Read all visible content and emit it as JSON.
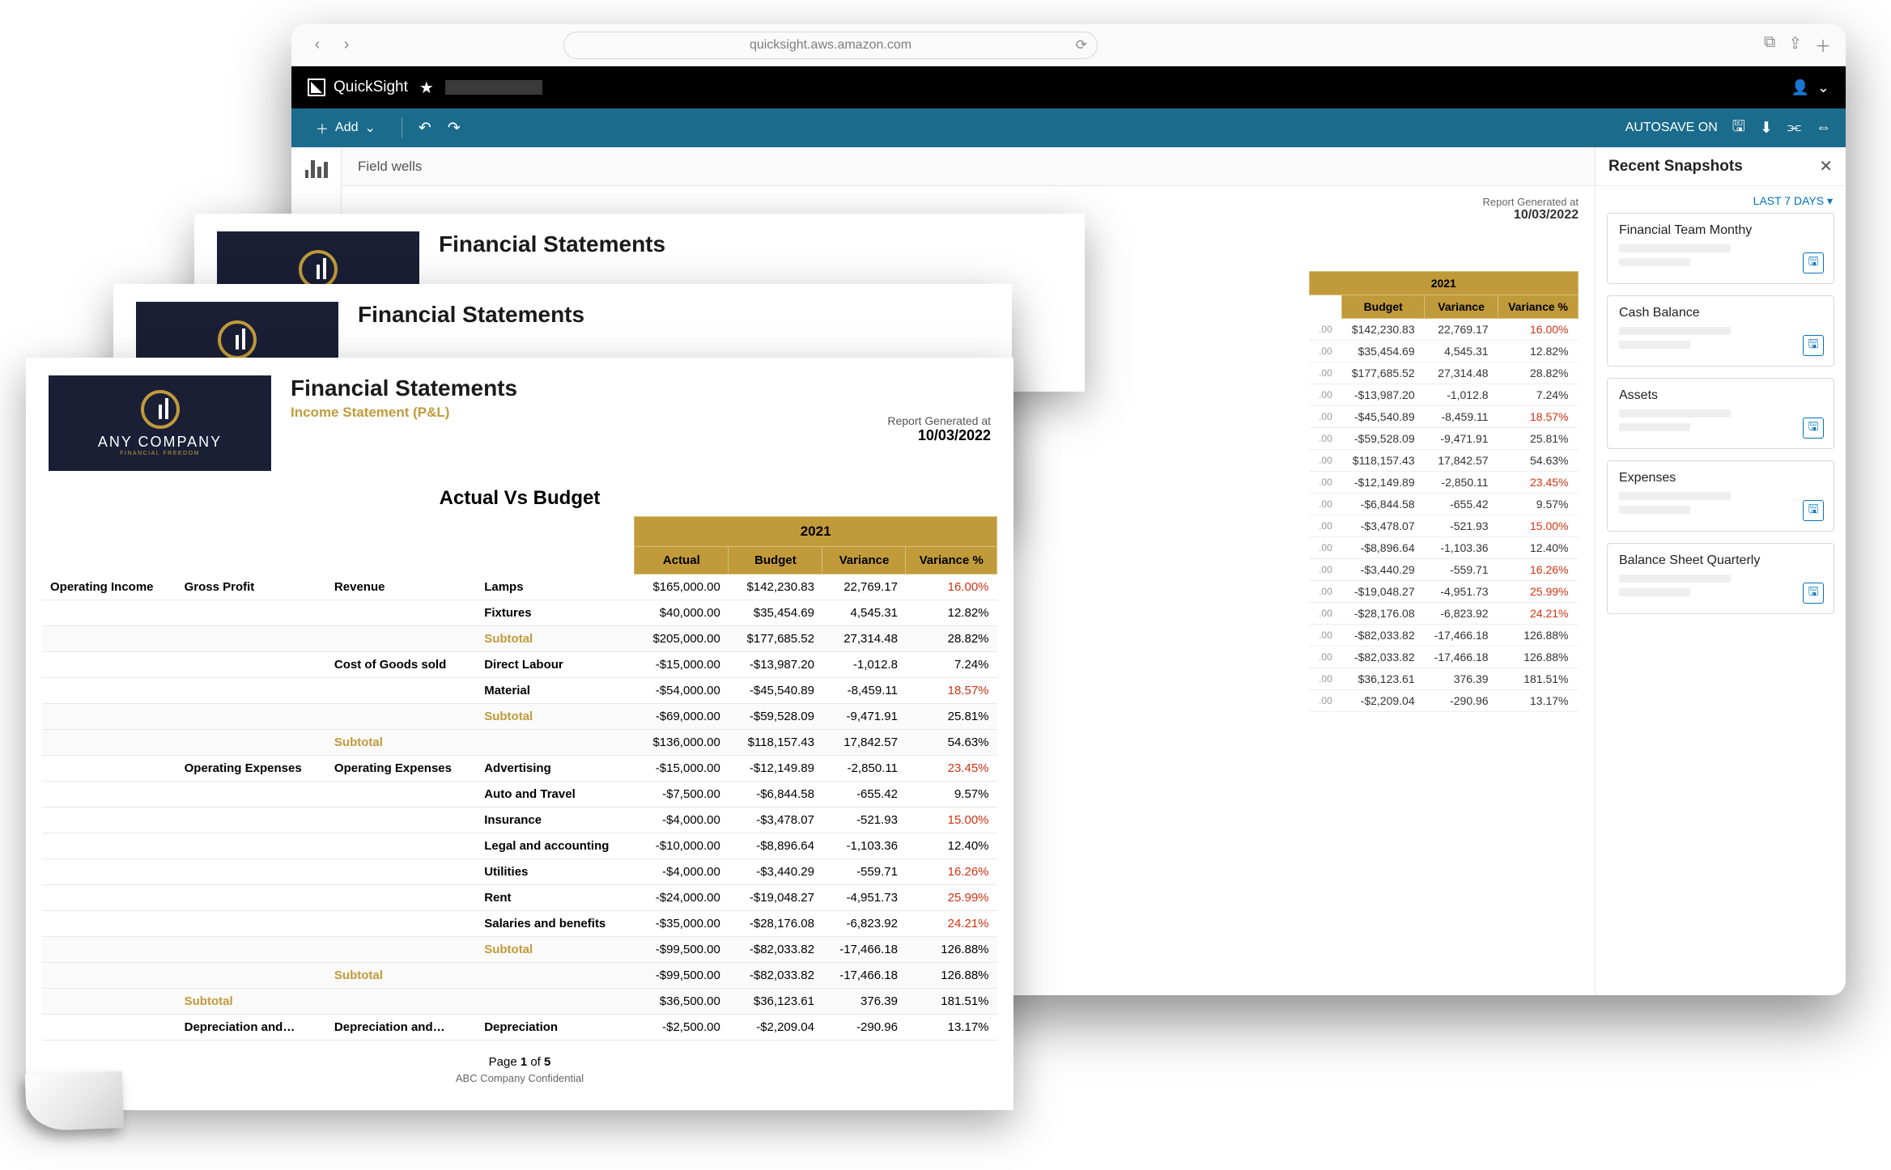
{
  "browser": {
    "url": "quicksight.aws.amazon.com"
  },
  "app": {
    "name": "QuickSight"
  },
  "toolbar": {
    "add": "Add",
    "autosave": "AUTOSAVE ON"
  },
  "fieldwells": "Field wells",
  "panel": {
    "title": "Recent Snapshots",
    "filter": "LAST 7 DAYS",
    "items": [
      "Financial Team Monthy",
      "Cash Balance",
      "Assets",
      "Expenses",
      "Balance Sheet Quarterly"
    ]
  },
  "report": {
    "company": "ANY COMPANY",
    "tag": "FINANCIAL FREEDOM",
    "title": "Financial Statements",
    "subtitle": "Income Statement  (P&L)",
    "generated_label": "Report Generated at",
    "generated_date": "10/03/2022",
    "section": "Actual Vs Budget",
    "year": "2021",
    "cols": [
      "Actual",
      "Budget",
      "Variance",
      "Variance %"
    ],
    "pager": "Page 1 of 5",
    "pager_b1": "1",
    "pager_b2": "5",
    "conf": "ABC Company Confidential"
  },
  "rows": [
    {
      "l1": "Operating Income",
      "l2": "Gross Profit",
      "l3": "Revenue",
      "l4": "Lamps",
      "a": "$165,000.00",
      "b": "$142,230.83",
      "v": "22,769.17",
      "p": "16.00%",
      "neg": true
    },
    {
      "l4": "Fixtures",
      "a": "$40,000.00",
      "b": "$35,454.69",
      "v": "4,545.31",
      "p": "12.82%"
    },
    {
      "sub": true,
      "l4": "Subtotal",
      "a": "$205,000.00",
      "b": "$177,685.52",
      "v": "27,314.48",
      "p": "28.82%"
    },
    {
      "l3": "Cost of Goods sold",
      "l4": "Direct Labour",
      "a": "-$15,000.00",
      "b": "-$13,987.20",
      "v": "-1,012.8",
      "p": "7.24%"
    },
    {
      "l4": "Material",
      "a": "-$54,000.00",
      "b": "-$45,540.89",
      "v": "-8,459.11",
      "p": "18.57%",
      "neg": true
    },
    {
      "sub": true,
      "l4": "Subtotal",
      "a": "-$69,000.00",
      "b": "-$59,528.09",
      "v": "-9,471.91",
      "p": "25.81%"
    },
    {
      "sub": true,
      "l3": "Subtotal",
      "a": "$136,000.00",
      "b": "$118,157.43",
      "v": "17,842.57",
      "p": "54.63%"
    },
    {
      "l2": "Operating Expenses",
      "l3": "Operating Expenses",
      "l4": "Advertising",
      "a": "-$15,000.00",
      "b": "-$12,149.89",
      "v": "-2,850.11",
      "p": "23.45%",
      "neg": true
    },
    {
      "l4": "Auto and Travel",
      "a": "-$7,500.00",
      "b": "-$6,844.58",
      "v": "-655.42",
      "p": "9.57%"
    },
    {
      "l4": "Insurance",
      "a": "-$4,000.00",
      "b": "-$3,478.07",
      "v": "-521.93",
      "p": "15.00%",
      "neg": true
    },
    {
      "l4": "Legal and accounting",
      "a": "-$10,000.00",
      "b": "-$8,896.64",
      "v": "-1,103.36",
      "p": "12.40%"
    },
    {
      "l4": "Utilities",
      "a": "-$4,000.00",
      "b": "-$3,440.29",
      "v": "-559.71",
      "p": "16.26%",
      "neg": true
    },
    {
      "l4": "Rent",
      "a": "-$24,000.00",
      "b": "-$19,048.27",
      "v": "-4,951.73",
      "p": "25.99%",
      "neg": true
    },
    {
      "l4": "Salaries and benefits",
      "a": "-$35,000.00",
      "b": "-$28,176.08",
      "v": "-6,823.92",
      "p": "24.21%",
      "neg": true
    },
    {
      "sub": true,
      "l4": "Subtotal",
      "a": "-$99,500.00",
      "b": "-$82,033.82",
      "v": "-17,466.18",
      "p": "126.88%"
    },
    {
      "sub": true,
      "l3": "Subtotal",
      "a": "-$99,500.00",
      "b": "-$82,033.82",
      "v": "-17,466.18",
      "p": "126.88%"
    },
    {
      "sub": true,
      "l2": "Subtotal",
      "a": "$36,500.00",
      "b": "$36,123.61",
      "v": "376.39",
      "p": "181.51%"
    },
    {
      "l2": "Depreciation and…",
      "l3": "Depreciation and…",
      "l4": "Depreciation",
      "a": "-$2,500.00",
      "b": "-$2,209.04",
      "v": "-290.96",
      "p": "13.17%"
    }
  ],
  "frag": {
    "generated_label": "Report Generated at",
    "date": "10/03/2022",
    "year": "2021",
    "cols": [
      "Budget",
      "Variance",
      "Variance %"
    ],
    "rows": [
      {
        "b": "$142,230.83",
        "v": "22,769.17",
        "p": "16.00%",
        "neg": true
      },
      {
        "b": "$35,454.69",
        "v": "4,545.31",
        "p": "12.82%"
      },
      {
        "b": "$177,685.52",
        "v": "27,314.48",
        "p": "28.82%"
      },
      {
        "b": "-$13,987.20",
        "v": "-1,012.8",
        "p": "7.24%"
      },
      {
        "b": "-$45,540.89",
        "v": "-8,459.11",
        "p": "18.57%",
        "neg": true
      },
      {
        "b": "-$59,528.09",
        "v": "-9,471.91",
        "p": "25.81%"
      },
      {
        "b": "$118,157.43",
        "v": "17,842.57",
        "p": "54.63%"
      },
      {
        "b": "-$12,149.89",
        "v": "-2,850.11",
        "p": "23.45%",
        "neg": true
      },
      {
        "b": "-$6,844.58",
        "v": "-655.42",
        "p": "9.57%"
      },
      {
        "b": "-$3,478.07",
        "v": "-521.93",
        "p": "15.00%",
        "neg": true
      },
      {
        "b": "-$8,896.64",
        "v": "-1,103.36",
        "p": "12.40%"
      },
      {
        "b": "-$3,440.29",
        "v": "-559.71",
        "p": "16.26%",
        "neg": true
      },
      {
        "b": "-$19,048.27",
        "v": "-4,951.73",
        "p": "25.99%",
        "neg": true
      },
      {
        "b": "-$28,176.08",
        "v": "-6,823.92",
        "p": "24.21%",
        "neg": true
      },
      {
        "b": "-$82,033.82",
        "v": "-17,466.18",
        "p": "126.88%"
      },
      {
        "b": "-$82,033.82",
        "v": "-17,466.18",
        "p": "126.88%"
      },
      {
        "b": "$36,123.61",
        "v": "376.39",
        "p": "181.51%"
      },
      {
        "b": "-$2,209.04",
        "v": "-290.96",
        "p": "13.17%"
      }
    ]
  }
}
